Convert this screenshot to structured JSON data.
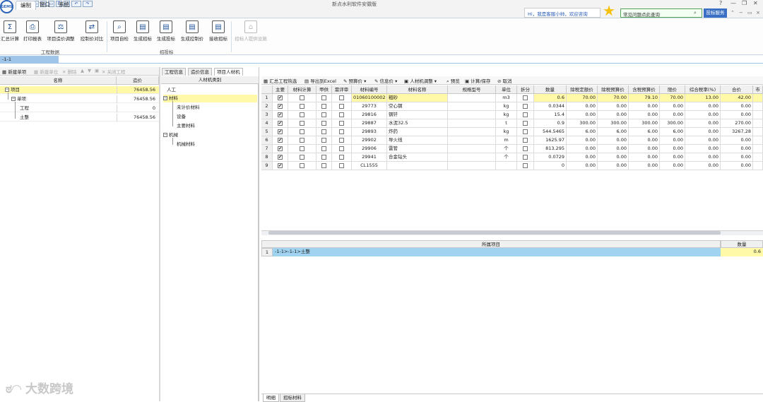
{
  "window": {
    "title": "新点水利软件安徽版",
    "logo_text": "GEMS"
  },
  "quick_access": [
    "+",
    "↶",
    "▭",
    "▭",
    "▭",
    "E",
    "▭",
    "↶",
    "↷"
  ],
  "menu": {
    "tabs": [
      "编制",
      "窗口",
      "系统"
    ]
  },
  "ribbon": {
    "groups": [
      {
        "label": "工程数据",
        "buttons": [
          "汇总计算",
          "打印报表",
          "项目造价调整",
          "控制价对比"
        ]
      },
      {
        "label": "招投标",
        "buttons": [
          "项目自检",
          "生成招标",
          "生成投标",
          "生成控制价",
          "接收招标"
        ]
      }
    ],
    "disabled_button": "招标人提供设施"
  },
  "helpbar": {
    "assistant": "Hi，我是客服小帅，欢迎咨询",
    "search_placeholder": "常见问题点此查询",
    "service_btn": "投标服务"
  },
  "path": "-1-1",
  "left": {
    "toolbar": [
      "新建单项",
      "新建单位",
      "删除",
      "关闭工程"
    ],
    "headers": [
      "名称",
      "造价"
    ],
    "rows": [
      {
        "name": "项目",
        "price": "76458.56",
        "toggle": "−"
      },
      {
        "name": "单项",
        "price": "76458.56",
        "toggle": "−"
      },
      {
        "name": "工程",
        "price": "0",
        "toggle": ""
      },
      {
        "name": "土整",
        "price": "76458.56",
        "toggle": ""
      }
    ]
  },
  "tabs": [
    "工程信息",
    "造价信息",
    "项目人材机"
  ],
  "categories": {
    "header": "人材机类别",
    "items": [
      "人工",
      "材料",
      "未计价材料",
      "设备",
      "主要材料",
      "机械",
      "机械材料"
    ]
  },
  "grid_toolbar": [
    "汇总工程热选",
    "导出到Excel",
    "预算价",
    "信息价",
    "人材机调整",
    "预览",
    "计算/保存",
    "取消"
  ],
  "grid": {
    "headers": [
      "",
      "主要",
      "材料计算",
      "甲供",
      "需评审",
      "材料编号",
      "材料名称",
      "规格型号",
      "单位",
      "折分",
      "数量",
      "除税定额价",
      "除税预算价",
      "含税预算价",
      "限价",
      "综合税率(%)",
      "合价",
      "市"
    ],
    "rows": [
      {
        "n": "1",
        "code": "01060100002",
        "name": "粗砂",
        "unit": "m3",
        "qty": "0.6",
        "ding": "70.00",
        "yusuan": "70.00",
        "hanshui": "79.10",
        "xian": "70.00",
        "rate": "13.00",
        "he": "42.00"
      },
      {
        "n": "2",
        "code": "29773",
        "name": "空心钢",
        "unit": "kg",
        "qty": "0.0344",
        "ding": "0.00",
        "yusuan": "0.00",
        "hanshui": "0.00",
        "xian": "0.00",
        "rate": "0.00",
        "he": "0.00"
      },
      {
        "n": "3",
        "code": "29816",
        "name": "钢钎",
        "unit": "kg",
        "qty": "15.4",
        "ding": "0.00",
        "yusuan": "0.00",
        "hanshui": "0.00",
        "xian": "0.00",
        "rate": "0.00",
        "he": "0.00"
      },
      {
        "n": "4",
        "code": "29887",
        "name": "水泥32.5",
        "unit": "t",
        "qty": "0.9",
        "ding": "300.00",
        "yusuan": "300.00",
        "hanshui": "300.00",
        "xian": "300.00",
        "rate": "0.00",
        "he": "270.00"
      },
      {
        "n": "5",
        "code": "29893",
        "name": "炸药",
        "unit": "kg",
        "qty": "544.5465",
        "ding": "6.00",
        "yusuan": "6.00",
        "hanshui": "6.00",
        "xian": "6.00",
        "rate": "0.00",
        "he": "3267.28"
      },
      {
        "n": "6",
        "code": "29902",
        "name": "导火线",
        "unit": "m",
        "qty": "1625.97",
        "ding": "0.00",
        "yusuan": "0.00",
        "hanshui": "0.00",
        "xian": "0.00",
        "rate": "0.00",
        "he": "0.00"
      },
      {
        "n": "7",
        "code": "29906",
        "name": "雷管",
        "unit": "个",
        "qty": "813.295",
        "ding": "0.00",
        "yusuan": "0.00",
        "hanshui": "0.00",
        "xian": "0.00",
        "rate": "0.00",
        "he": "0.00"
      },
      {
        "n": "8",
        "code": "29941",
        "name": "合金钻头",
        "unit": "个",
        "qty": "0.0729",
        "ding": "0.00",
        "yusuan": "0.00",
        "hanshui": "0.00",
        "xian": "0.00",
        "rate": "0.00",
        "he": "0.00"
      },
      {
        "n": "9",
        "code": "CL1555",
        "name": "",
        "unit": "",
        "qty": "0",
        "ding": "0.00",
        "yusuan": "0.00",
        "hanshui": "0.00",
        "xian": "0.00",
        "rate": "0.00",
        "he": "0.00"
      }
    ]
  },
  "sub": {
    "header_project": "所属项目",
    "header_qty": "数量",
    "row_n": "1",
    "path": "-1-1>-1-1>土整",
    "qty": "0.6"
  },
  "bottom_tabs": [
    "明细",
    "招标材料"
  ],
  "watermark": "大数跨境",
  "colors": {
    "selected_row": "#fff9a8",
    "path_bar": "#9fc5e8",
    "sub_path": "#9fd3f0",
    "accent": "#3a6fc4"
  }
}
